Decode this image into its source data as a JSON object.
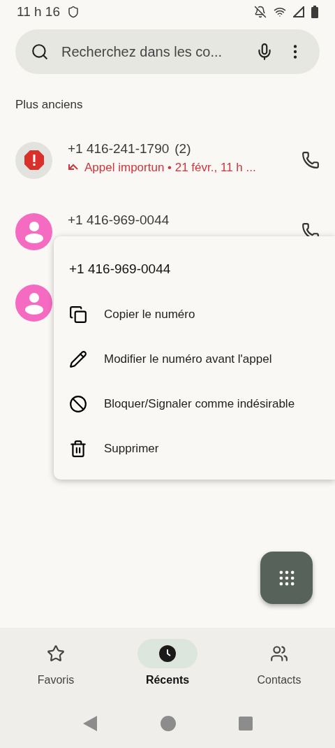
{
  "status_bar": {
    "time": "11 h 16"
  },
  "search": {
    "placeholder": "Recherchez dans les co..."
  },
  "section_title": "Plus anciens",
  "calls": [
    {
      "kind": "spam",
      "number": "+1 416-241-1790",
      "count": "(2)",
      "detail": "Appel importun • 21 févr., 11 h ..."
    },
    {
      "kind": "contact",
      "number": "+1 416-969-0044"
    },
    {
      "kind": "contact"
    }
  ],
  "menu": {
    "title": "+1 416-969-0044",
    "items": [
      {
        "kind": "copy",
        "label": "Copier le numéro"
      },
      {
        "kind": "edit",
        "label": "Modifier le numéro avant l'appel"
      },
      {
        "kind": "block",
        "label": "Bloquer/Signaler comme indésirable"
      },
      {
        "kind": "delete",
        "label": "Supprimer"
      }
    ]
  },
  "tabs": [
    {
      "kind": "favorites",
      "label": "Favoris",
      "selected": false
    },
    {
      "kind": "recents",
      "label": "Récents",
      "selected": true
    },
    {
      "kind": "contacts",
      "label": "Contacts",
      "selected": false
    }
  ]
}
